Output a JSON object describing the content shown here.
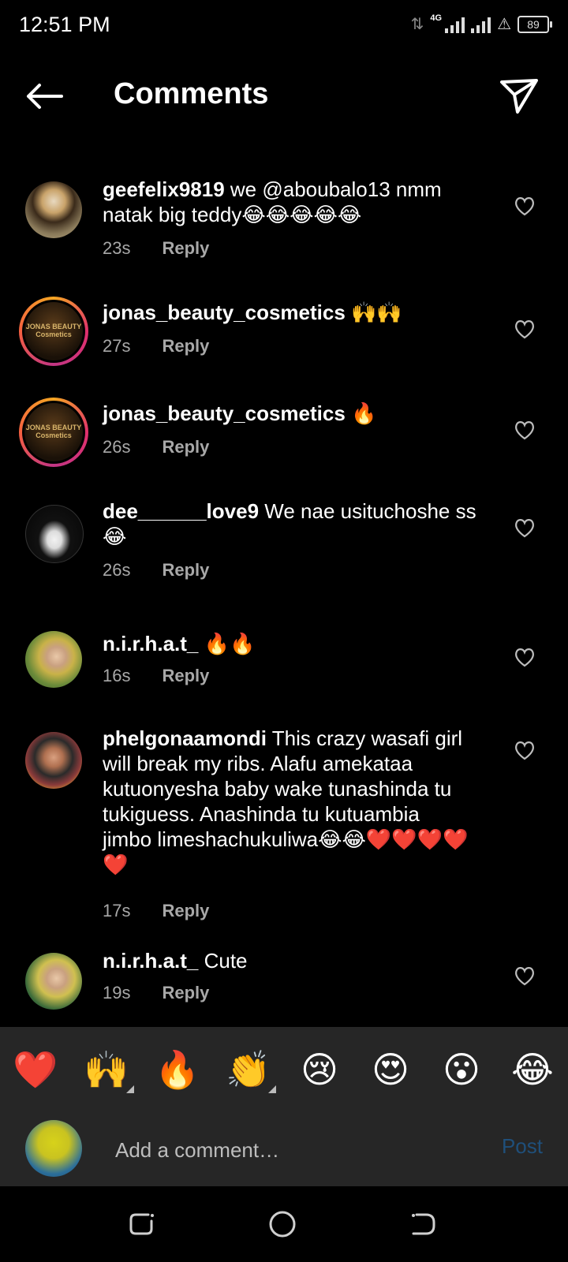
{
  "status": {
    "time": "12:51 PM",
    "network": "4G",
    "battery": "89"
  },
  "header": {
    "title": "Comments"
  },
  "comments": [
    {
      "username": "geefelix9819",
      "text": " we @aboubalo13  nmm natak big teddy😂😂😂😂😂",
      "time": "23s",
      "reply": "Reply"
    },
    {
      "username": "jonas_beauty_cosmetics",
      "text": " 🙌🙌",
      "time": "27s",
      "reply": "Reply"
    },
    {
      "username": "jonas_beauty_cosmetics",
      "text": " 🔥",
      "time": "26s",
      "reply": "Reply"
    },
    {
      "username": "dee______love9",
      "text": " We nae usituchoshe ss 😂",
      "time": "26s",
      "reply": "Reply"
    },
    {
      "username": "n.i.r.h.a.t_",
      "text": " 🔥🔥",
      "time": "16s",
      "reply": "Reply"
    },
    {
      "username": "phelgonaamondi",
      "text": " This crazy wasafi girl will break my ribs. Alafu amekataa kutuonyesha baby wake tunashinda tu tukiguess. Anashinda tu kutuambia jimbo limeshachukuliwa😂😂❤️❤️❤️❤️❤️",
      "time": "17s",
      "reply": "Reply"
    },
    {
      "username": "n.i.r.h.a.t_",
      "text": " Cute",
      "time": "19s",
      "reply": "Reply"
    }
  ],
  "logo_text": {
    "line1": "JONAS BEAUTY",
    "line2": "Cosmetics"
  },
  "emoji_bar": [
    "❤️",
    "🙌",
    "🔥",
    "👏",
    "😢",
    "😍",
    "😮",
    "😂"
  ],
  "composer": {
    "placeholder": "Add a comment…",
    "post_label": "Post"
  },
  "colors": {
    "background": "#000000",
    "panel": "#262626",
    "muted": "#a8a8a8",
    "post_disabled": "#1f4f7a"
  }
}
